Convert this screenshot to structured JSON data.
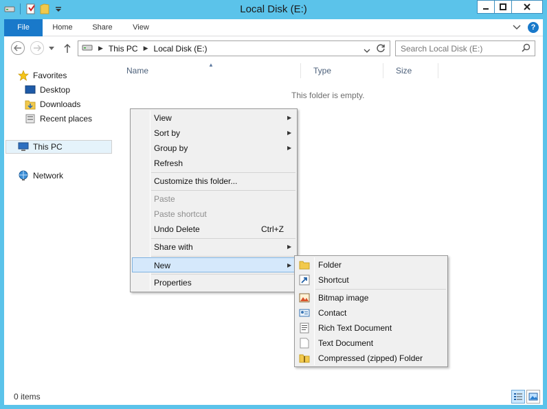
{
  "window": {
    "title": "Local Disk (E:)"
  },
  "ribbon": {
    "tabs": [
      "File",
      "Home",
      "Share",
      "View"
    ],
    "help_label": "?"
  },
  "address": {
    "crumbs": [
      "This PC",
      "Local Disk (E:)"
    ],
    "search_placeholder": "Search Local Disk (E:)"
  },
  "nav": {
    "favorites": "Favorites",
    "desktop": "Desktop",
    "downloads": "Downloads",
    "recent": "Recent places",
    "thispc": "This PC",
    "network": "Network"
  },
  "columns": [
    "Name",
    "Type",
    "Size"
  ],
  "empty_text": "This folder is empty.",
  "status": {
    "items": "0 items"
  },
  "context_menu": {
    "view": "View",
    "sort_by": "Sort by",
    "group_by": "Group by",
    "refresh": "Refresh",
    "customize": "Customize this folder...",
    "paste": "Paste",
    "paste_shortcut": "Paste shortcut",
    "undo_delete": "Undo Delete",
    "undo_shortcut": "Ctrl+Z",
    "share_with": "Share with",
    "new": "New",
    "properties": "Properties"
  },
  "new_submenu": {
    "folder": "Folder",
    "shortcut": "Shortcut",
    "bitmap": "Bitmap image",
    "contact": "Contact",
    "rtf": "Rich Text Document",
    "text": "Text Document",
    "zip": "Compressed (zipped) Folder"
  }
}
